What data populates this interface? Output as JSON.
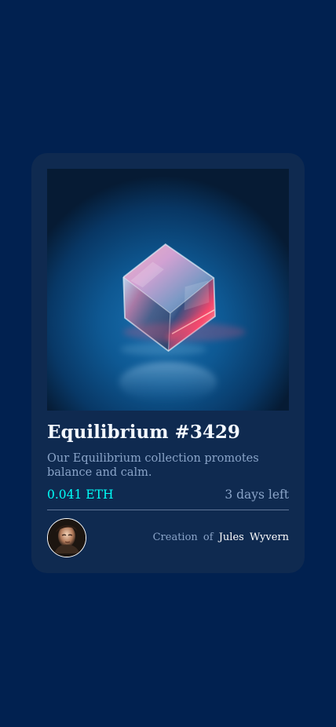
{
  "card": {
    "title": "Equilibrium #3429",
    "description": "Our Equilibrium collection promotes balance and calm.",
    "price": "0.041 ETH",
    "time_left": "3 days left",
    "creator_prefix": "Creation of",
    "creator_name": "Jules Wyvern",
    "image_name": "equilibrium-cube-image",
    "avatar_name": "creator-avatar"
  },
  "colors": {
    "page_background": "#012150",
    "card_background": "#0f2a50",
    "price_accent": "#00fff8",
    "muted_text": "#8aa4c8",
    "title_text": "#f3f8ff",
    "divider": "#5f7598"
  }
}
